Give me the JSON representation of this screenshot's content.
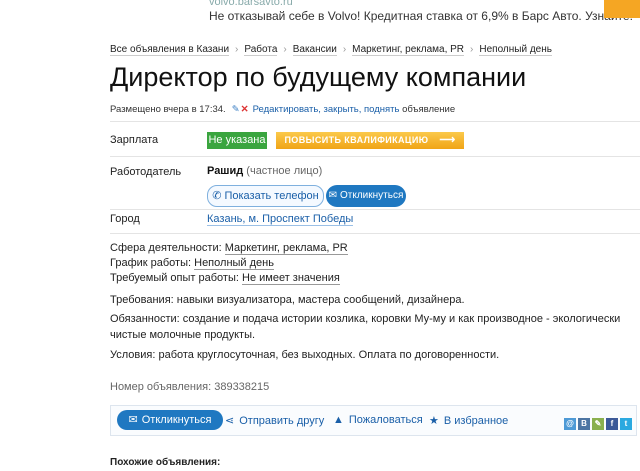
{
  "ad": {
    "url": "volvo.barsavto.ru",
    "text": "Не отказывай себе в Volvo! Кредитная ставка от 6,9% в Барс Авто. Узнайте:"
  },
  "breadcrumbs": [
    "Все объявления в Казани",
    "Работа",
    "Вакансии",
    "Маркетинг, реклама, PR",
    "Неполный день"
  ],
  "title": "Директор по будущему компании",
  "posted": {
    "text": "Размещено вчера в 17:34.",
    "edit_link": "Редактировать, закрыть, поднять",
    "edit_suffix": "объявление"
  },
  "salary": {
    "label": "Зарплата",
    "value": "Не указана",
    "boost_button": "ПОВЫСИТЬ КВАЛИФИКАЦИЮ"
  },
  "employer": {
    "label": "Работодатель",
    "name": "Рашид",
    "type": "(частное лицо)",
    "show_phone": "Показать телефон",
    "respond": "Откликнуться"
  },
  "city": {
    "label": "Город",
    "value": "Казань, м. Проспект Победы"
  },
  "details": {
    "sphere_label": "Сфера деятельности:",
    "sphere_value": "Маркетинг, реклама, PR",
    "schedule_label": "График работы:",
    "schedule_value": "Неполный день",
    "experience_label": "Требуемый опыт работы:",
    "experience_value": "Не имеет значения"
  },
  "requirements": "Требования: навыки визуализатора, мастера сообщений, дизайнера.",
  "duties": "Обязанности: создание и подача истории козлика, коровки Му-му и как производное - экологически чистые молочные продукты.",
  "conditions": "Условия: работа круглосуточная, без выходных. Оплата по договоренности.",
  "ad_number": "Номер объявления: 389338215",
  "actions": {
    "respond": "Откликнуться",
    "send_friend": "Отправить другу",
    "complain": "Пожаловаться",
    "favorite": "В избранное"
  },
  "similar_heading": "Похожие объявления:",
  "colors": {
    "link": "#1a5fa8",
    "green_badge": "#3aa53f",
    "orange_button": "#f0a416",
    "blue_button": "#1f78c1"
  }
}
